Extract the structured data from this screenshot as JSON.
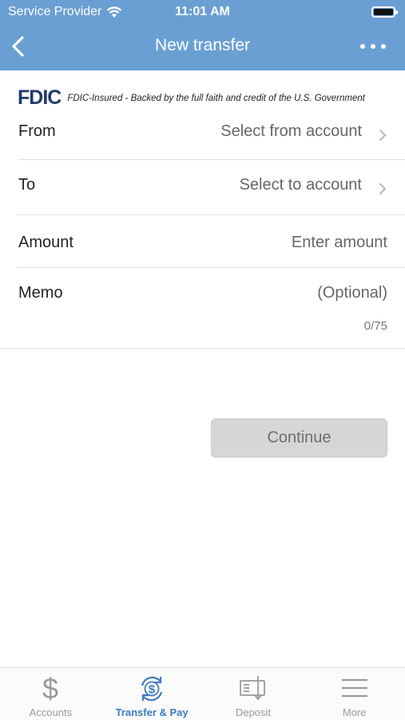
{
  "status_bar": {
    "carrier": "Service Provider",
    "time": "11:01 AM"
  },
  "nav": {
    "title": "New transfer",
    "back_icon": "chevron-left-icon",
    "more_icon": "ellipsis-icon"
  },
  "fdic": {
    "logo": "FDIC",
    "text": "FDIC-Insured - Backed by the full faith and credit of the U.S. Government"
  },
  "form": {
    "from": {
      "label": "From",
      "value": "Select from account"
    },
    "to": {
      "label": "To",
      "value": "Select to account"
    },
    "amount": {
      "label": "Amount",
      "placeholder": "Enter amount"
    },
    "memo": {
      "label": "Memo",
      "placeholder": "(Optional)",
      "counter": "0/75"
    }
  },
  "continue_label": "Continue",
  "tabbar": {
    "tabs": [
      {
        "label": "Accounts",
        "icon": "dollar-icon",
        "active": false
      },
      {
        "label": "Transfer & Pay",
        "icon": "transfer-icon",
        "active": true
      },
      {
        "label": "Deposit",
        "icon": "check-deposit-icon",
        "active": false
      },
      {
        "label": "More",
        "icon": "menu-icon",
        "active": false
      }
    ]
  },
  "colors": {
    "header": "#6a9fd4",
    "active_tab": "#3f7bc0",
    "fdic_logo": "#1e3a6b"
  }
}
